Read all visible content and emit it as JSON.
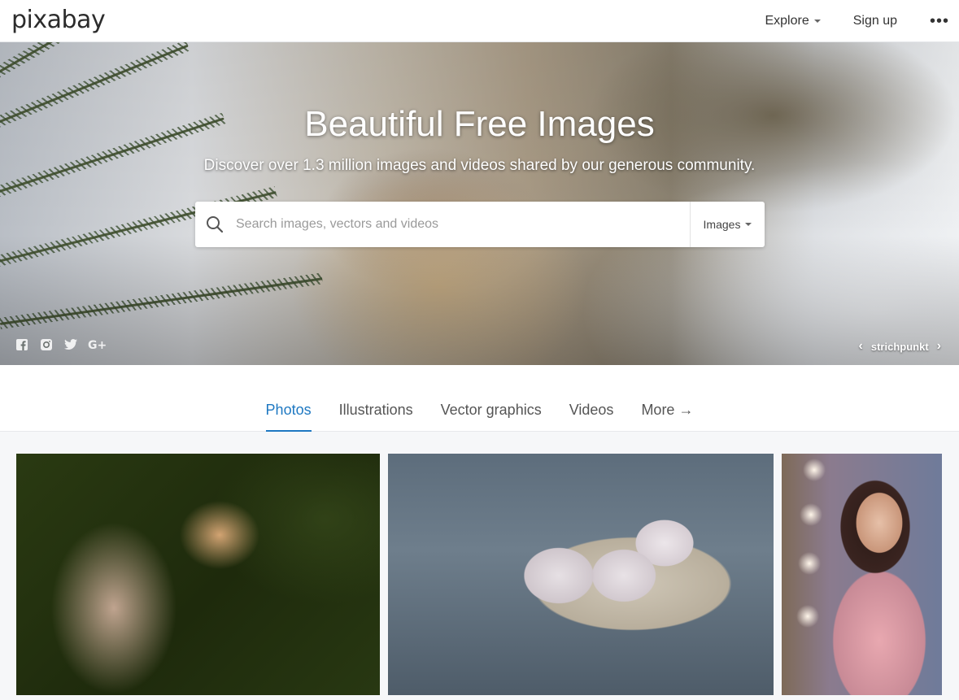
{
  "header": {
    "logo": "pixabay",
    "nav": {
      "explore": "Explore",
      "signup": "Sign up",
      "more": "•••"
    }
  },
  "hero": {
    "title": "Beautiful Free Images",
    "subtitle": "Discover over 1.3 million images and videos shared by our generous community.",
    "search": {
      "placeholder": "Search images, vectors and videos",
      "value": "",
      "type_selected": "Images"
    },
    "social_icons": [
      "facebook-icon",
      "instagram-icon",
      "twitter-icon",
      "google-plus-icon"
    ],
    "credit": {
      "prev": "‹",
      "author": "strichpunkt",
      "next": "›"
    }
  },
  "tabs": [
    {
      "label": "Photos",
      "active": true
    },
    {
      "label": "Illustrations",
      "active": false
    },
    {
      "label": "Vector graphics",
      "active": false
    },
    {
      "label": "Videos",
      "active": false
    },
    {
      "label": "More →",
      "active": false
    }
  ],
  "gallery": [
    {
      "subject": "flamingo"
    },
    {
      "subject": "eggs in carton"
    },
    {
      "subject": "girl in pink dress"
    }
  ],
  "colors": {
    "accent": "#1e78c2",
    "header_bg": "#ffffff",
    "page_bg": "#f6f7f9"
  }
}
